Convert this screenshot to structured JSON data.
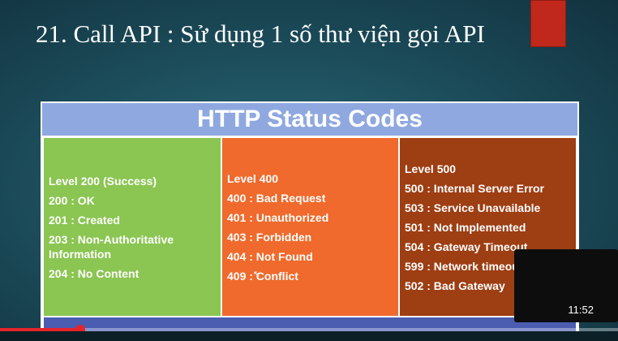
{
  "slide": {
    "title": "21. Call API : Sử dụng 1 số thư viện gọi API",
    "accent_color": "#c0281b"
  },
  "table": {
    "header": "HTTP Status Codes",
    "columns": [
      {
        "heading": "Level 200 (Success)",
        "items": [
          "200 : OK",
          "201 : Created",
          "203 : Non-Authoritative Information",
          "204 : No Content"
        ],
        "color": "#8bc552"
      },
      {
        "heading": "Level 400",
        "items": [
          "400 : Bad Request",
          "401 : Unauthorized",
          "403 : Forbidden",
          "404 : Not Found",
          "409 : Conflict"
        ],
        "color": "#ef6a2c"
      },
      {
        "heading": "Level 500",
        "items": [
          "500 : Internal Server Error",
          "503 : Service Unavailable",
          "501 : Not Implemented",
          "504 : Gateway Timeout",
          "599 : Network timeout",
          "502 : Bad Gateway"
        ],
        "color": "#9e3e13"
      }
    ]
  },
  "player": {
    "preview_time": "11:52",
    "progress_fraction": 0.13,
    "progress_color": "#e5242b"
  }
}
